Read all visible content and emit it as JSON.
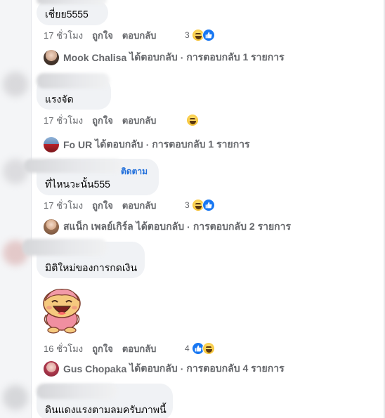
{
  "comments": [
    {
      "text": "เชี่ยย5555",
      "actions": {
        "time": "17 ชั่วโมง",
        "like": "ถูกใจ",
        "reply": "ตอบกลับ"
      },
      "reactions": {
        "count": "3",
        "icons": [
          "haha-icon",
          "like-icon"
        ]
      },
      "reply_summary": {
        "name": "Mook Chalisa",
        "verb": "ได้ตอบกลับ",
        "dot": "·",
        "count_text": "การตอบกลับ 1 รายการ"
      }
    },
    {
      "text": "แรงจัด",
      "actions": {
        "time": "17 ชั่วโมง",
        "like": "ถูกใจ",
        "reply": "ตอบกลับ"
      },
      "reactions": {
        "count": "",
        "icons": [
          "haha-icon"
        ]
      },
      "reply_summary": {
        "name": "Fo UR",
        "verb": "ได้ตอบกลับ",
        "dot": "·",
        "count_text": "การตอบกลับ 1 รายการ"
      }
    },
    {
      "follow_label": "ติดตาม",
      "text": "ที่ไหนวะนั้น555",
      "actions": {
        "time": "17 ชั่วโมง",
        "like": "ถูกใจ",
        "reply": "ตอบกลับ"
      },
      "reactions": {
        "count": "3",
        "icons": [
          "haha-icon",
          "like-icon"
        ]
      },
      "reply_summary": {
        "name": "สแน็ก เพลย์เกิร์ล",
        "verb": "ได้ตอบกลับ",
        "dot": "·",
        "count_text": "การตอบกลับ 2 รายการ"
      }
    },
    {
      "text": "มิติใหม่ของการกดเงิน",
      "sticker": "laughing-character-sticker",
      "actions": {
        "time": "16 ชั่วโมง",
        "like": "ถูกใจ",
        "reply": "ตอบกลับ"
      },
      "reactions": {
        "count": "4",
        "icons": [
          "like-icon",
          "haha-icon"
        ]
      },
      "reply_summary": {
        "name": "Gus Chopaka",
        "verb": "ได้ตอบกลับ",
        "dot": "·",
        "count_text": "การตอบกลับ 4 รายการ"
      }
    },
    {
      "text": "ดินแดงแรงตามลมครับภาพนี้"
    }
  ],
  "colors": {
    "bubble": "#f0f2f5",
    "meta_text": "#65676b",
    "link": "#216fdb",
    "like_blue": "#1877f2",
    "haha_yellow": "#f7c537"
  }
}
